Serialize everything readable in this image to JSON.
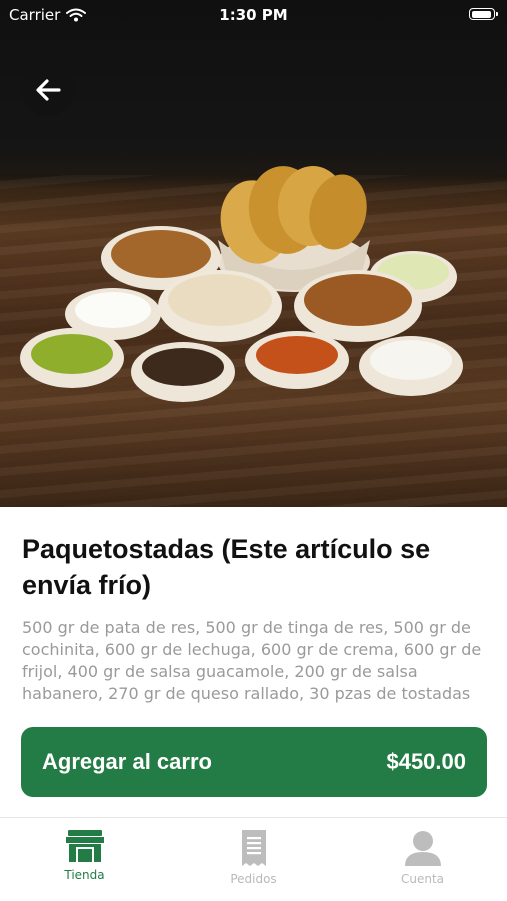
{
  "status_bar": {
    "carrier": "Carrier",
    "time": "1:30 PM"
  },
  "product": {
    "title": "Paquetostadas (Este artículo se envía frío)",
    "description": "500 gr de pata de res, 500 gr de tinga de res, 500 gr de cochinita, 600 gr de lechuga, 600 gr de crema, 600 gr de frijol, 400 gr de salsa guacamole, 200 gr de salsa habanero, 270 gr de queso rallado, 30 pzas de tostadas"
  },
  "cart_button": {
    "label": "Agregar al carro",
    "price": "$450.00"
  },
  "tabs": [
    {
      "label": "Tienda",
      "icon": "store-icon",
      "active": true
    },
    {
      "label": "Pedidos",
      "icon": "receipt-icon",
      "active": false
    },
    {
      "label": "Cuenta",
      "icon": "user-icon",
      "active": false
    }
  ],
  "colors": {
    "primary": "#237c45",
    "inactive": "#b9b9b9",
    "description": "#9a9a9a"
  }
}
